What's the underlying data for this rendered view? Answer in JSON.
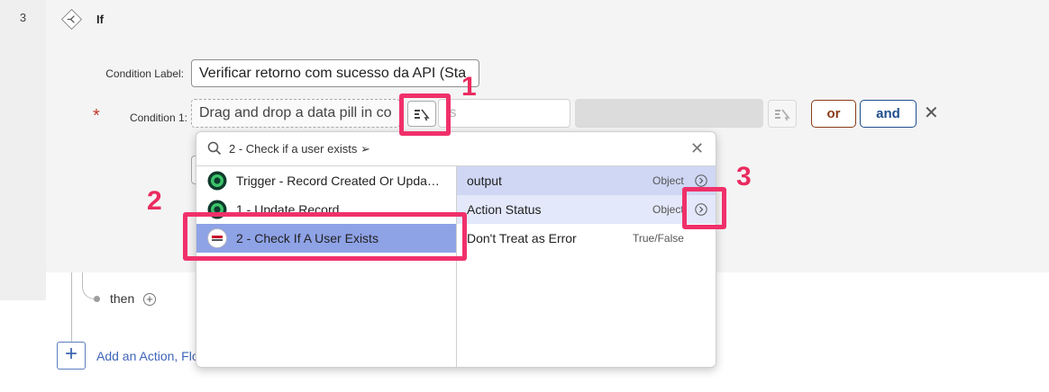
{
  "step": {
    "number": "3",
    "title": "If",
    "icon": "if-branch-icon"
  },
  "condition_label": {
    "label": "Condition Label:",
    "value": "Verificar retorno com sucesso da API (Sta"
  },
  "condition_1": {
    "required_mark": "*",
    "label": "Condition 1:",
    "drop_placeholder": "Drag and drop a data pill in co",
    "operator_placeholder": "is",
    "or_label": "or",
    "and_label": "and",
    "remove_icon": "close-icon"
  },
  "flow": {
    "then_label": "then",
    "add_action_label": "Add an Action, Flo"
  },
  "popover": {
    "search_text": "2 - Check if a user exists ➢",
    "close_symbol": "✕",
    "sources": [
      {
        "label": "Trigger - Record Created Or Upda…",
        "icon": "trigger-icon"
      },
      {
        "label": "1 - Update Record",
        "icon": "action-icon"
      },
      {
        "label": "2 - Check If A User Exists",
        "icon": "access-hub-icon",
        "selected": true
      }
    ],
    "pills": [
      {
        "name": "output",
        "type": "Object",
        "expandable": true
      },
      {
        "name": "Action Status",
        "type": "Object",
        "expandable": true
      },
      {
        "name": "Don't Treat as Error",
        "type": "True/False",
        "expandable": false
      }
    ]
  },
  "annotations": {
    "callout_1": "1",
    "callout_2": "2",
    "callout_3": "3",
    "color": "#f0306a"
  }
}
